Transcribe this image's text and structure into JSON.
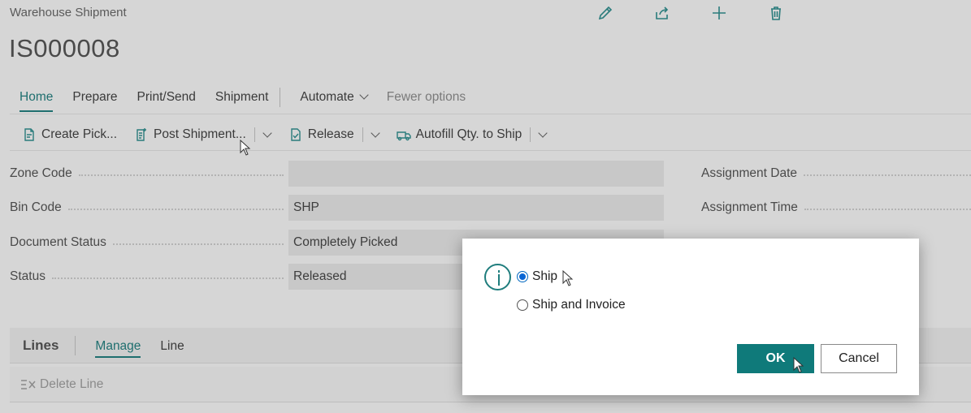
{
  "page": {
    "breadcrumb": "Warehouse Shipment",
    "doc_no": "IS000008"
  },
  "top_actions": [
    {
      "name": "edit-icon"
    },
    {
      "name": "share-icon"
    },
    {
      "name": "plus-icon"
    },
    {
      "name": "delete-icon"
    }
  ],
  "tabs": {
    "home": "Home",
    "prepare": "Prepare",
    "print_send": "Print/Send",
    "shipment": "Shipment",
    "automate": "Automate",
    "fewer": "Fewer options"
  },
  "actions": {
    "create_pick": "Create Pick...",
    "post_shipment": "Post Shipment...",
    "release": "Release",
    "autofill": "Autofill Qty. to Ship"
  },
  "fields": {
    "zone_code": {
      "label": "Zone Code",
      "value": ""
    },
    "bin_code": {
      "label": "Bin Code",
      "value": "SHP"
    },
    "document_status": {
      "label": "Document Status",
      "value": "Completely Picked"
    },
    "status": {
      "label": "Status",
      "value": "Released"
    }
  },
  "right_fields": {
    "assignment_date": "Assignment Date",
    "assignment_time": "Assignment Time"
  },
  "lines": {
    "title": "Lines",
    "manage": "Manage",
    "line": "Line",
    "delete_line": "Delete Line"
  },
  "dialog": {
    "option_ship": "Ship",
    "option_ship_invoice": "Ship and Invoice",
    "selected": "Ship",
    "ok": "OK",
    "cancel": "Cancel"
  },
  "colors": {
    "accent": "#0f7a7a",
    "radio": "#0a66d4"
  }
}
